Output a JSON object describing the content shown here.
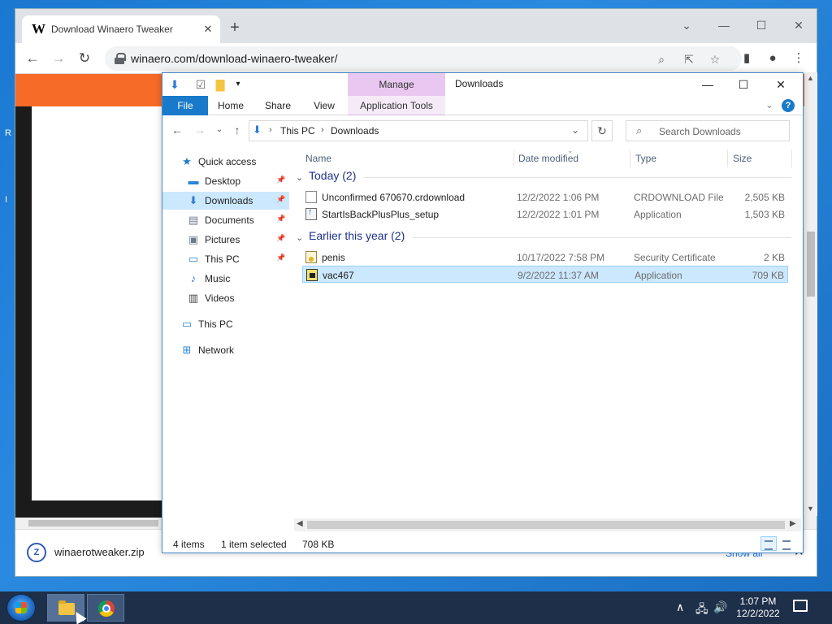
{
  "desktop": {
    "edge_text_1": "R",
    "edge_text_2": "I"
  },
  "browser": {
    "tab_favicon": "W",
    "tab_title": "Download Winaero Tweaker",
    "url": "winaero.com/download-winaero-tweaker/",
    "icons": {
      "back": "←",
      "forward": "→",
      "reload": "↻",
      "zoom": "⌕",
      "share": "⇱",
      "star": "☆",
      "sidepanel": "▮",
      "profile": "●",
      "menu": "⋮",
      "close": "✕",
      "newtab": "+",
      "minimize": "—",
      "maximize": "☐",
      "chevron": "⌄"
    },
    "download": {
      "filename": "winaerotweaker.zip",
      "show_all": "Show all"
    }
  },
  "explorer": {
    "title": "Downloads",
    "manage_label": "Manage",
    "ribbon_tabs": [
      "File",
      "Home",
      "Share",
      "View"
    ],
    "application_tools": "Application Tools",
    "breadcrumb": [
      "This PC",
      "Downloads"
    ],
    "search_placeholder": "Search Downloads",
    "nav": [
      {
        "label": "Quick access",
        "icon": "star-icon",
        "glyph": "★",
        "color": "#1979ca",
        "pinned": false,
        "selected": false
      },
      {
        "label": "Desktop",
        "icon": "desktop-icon",
        "glyph": "▬",
        "color": "#2a84d6",
        "pinned": true,
        "selected": false
      },
      {
        "label": "Downloads",
        "icon": "download-arrow-icon",
        "glyph": "⬇",
        "color": "#2a7bd6",
        "pinned": true,
        "selected": true
      },
      {
        "label": "Documents",
        "icon": "documents-icon",
        "glyph": "▤",
        "color": "#6b7b8c",
        "pinned": true,
        "selected": false
      },
      {
        "label": "Pictures",
        "icon": "pictures-icon",
        "glyph": "▣",
        "color": "#6b7b8c",
        "pinned": true,
        "selected": false
      },
      {
        "label": "This PC",
        "icon": "computer-icon",
        "glyph": "▭",
        "color": "#2a84d6",
        "pinned": true,
        "selected": false
      },
      {
        "label": "Music",
        "icon": "music-icon",
        "glyph": "♪",
        "color": "#2a7bd6",
        "pinned": false,
        "selected": false
      },
      {
        "label": "Videos",
        "icon": "videos-icon",
        "glyph": "▥",
        "color": "#444444",
        "pinned": false,
        "selected": false
      },
      {
        "label": "This PC",
        "icon": "computer-icon",
        "glyph": "▭",
        "color": "#2a84d6",
        "pinned": false,
        "selected": false
      },
      {
        "label": "Network",
        "icon": "network-icon",
        "glyph": "⊞",
        "color": "#2a84d6",
        "pinned": false,
        "selected": false
      }
    ],
    "columns": {
      "name": "Name",
      "date": "Date modified",
      "type": "Type",
      "size": "Size"
    },
    "groups": [
      {
        "label": "Today (2)",
        "files": [
          {
            "name": "Unconfirmed 670670.crdownload",
            "date": "12/2/2022 1:06 PM",
            "type": "CRDOWNLOAD File",
            "size": "2,505 KB",
            "icon": "doc",
            "selected": false
          },
          {
            "name": "StartIsBackPlusPlus_setup",
            "date": "12/2/2022 1:01 PM",
            "type": "Application",
            "size": "1,503 KB",
            "icon": "app",
            "selected": false
          }
        ]
      },
      {
        "label": "Earlier this year (2)",
        "files": [
          {
            "name": "penis",
            "date": "10/17/2022 7:58 PM",
            "type": "Security Certificate",
            "size": "2 KB",
            "icon": "cert",
            "selected": false
          },
          {
            "name": "vac467",
            "date": "9/2/2022 11:37 AM",
            "type": "Application",
            "size": "709 KB",
            "icon": "vac",
            "selected": true
          }
        ]
      }
    ],
    "status": {
      "items": "4 items",
      "selected": "1 item selected",
      "size": "708 KB"
    }
  },
  "taskbar": {
    "time": "1:07 PM",
    "date": "12/2/2022",
    "tray": {
      "chevron": "∧",
      "network": "🖧",
      "volume": "🔊"
    }
  }
}
